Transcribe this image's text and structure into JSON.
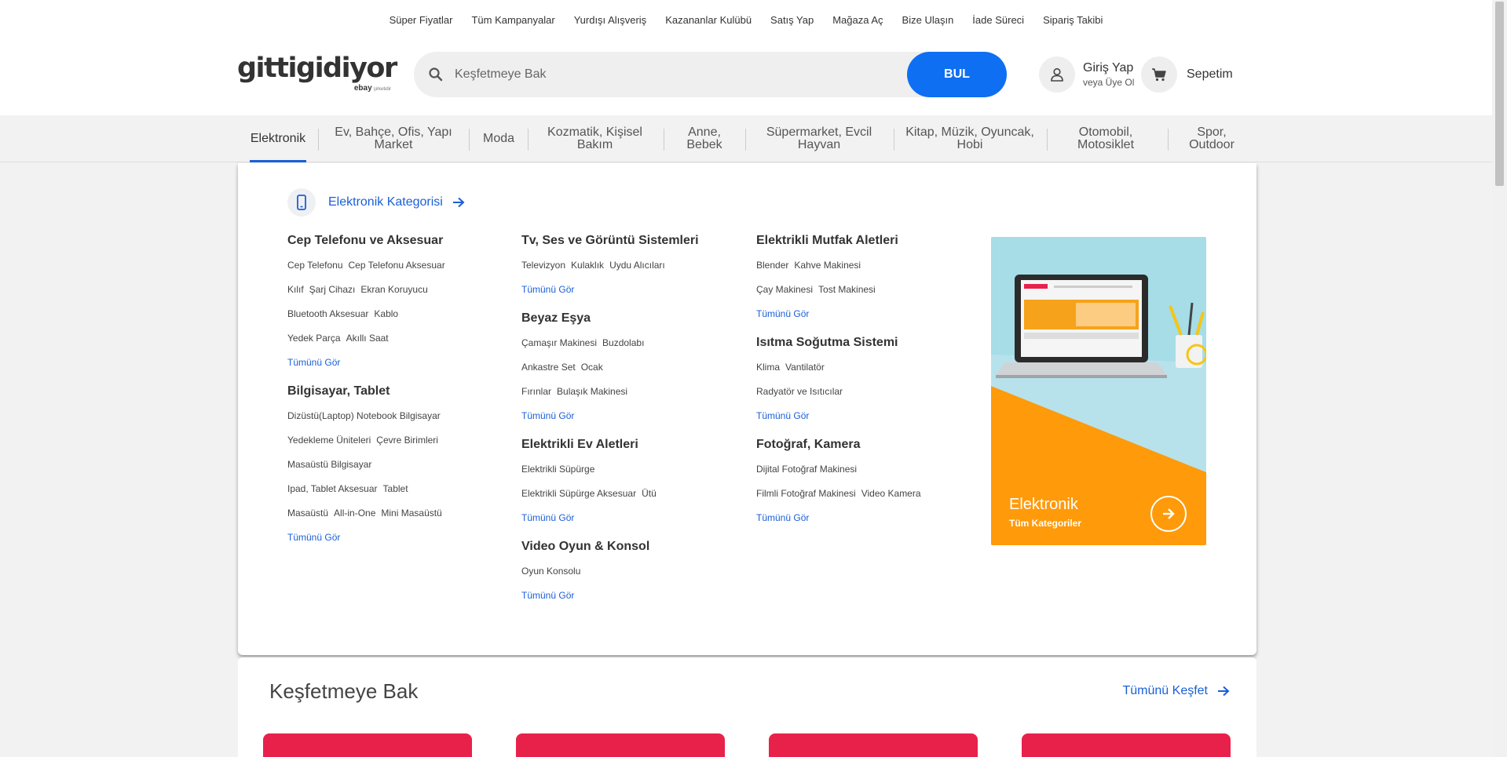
{
  "top_links": [
    "Süper Fiyatlar",
    "Tüm Kampanyalar",
    "Yurdışı Alışveriş",
    "Kazananlar Kulübü",
    "Satış Yap",
    "Mağaza Aç",
    "Bize Ulaşın",
    "İade Süreci",
    "Sipariş Takibi"
  ],
  "logo": {
    "text": "gittigidiyor",
    "sub": "ebay",
    "sub_small": "şirketidir"
  },
  "search": {
    "placeholder": "Keşfetmeye Bak",
    "button": "BUL"
  },
  "account": {
    "label": "Giriş Yap",
    "sublabel": "veya Üye Ol"
  },
  "cart": {
    "label": "Sepetim"
  },
  "categories": [
    "Elektronik",
    "Ev, Bahçe, Ofis, Yapı Market",
    "Moda",
    "Kozmatik, Kişisel Bakım",
    "Anne, Bebek",
    "Süpermarket, Evcil Hayvan",
    "Kitap, Müzik, Oyuncak, Hobi",
    "Otomobil, Motosiklet",
    "Spor, Outdoor"
  ],
  "active_category": "Elektronik",
  "mega_menu": {
    "heading": "Elektronik Kategorisi",
    "see_all": "Tümünü Gör",
    "col1": [
      {
        "title": "Cep Telefonu ve Aksesuar",
        "rows": [
          [
            "Cep Telefonu",
            "Cep Telefonu Aksesuar"
          ],
          [
            "Kılıf",
            "Şarj Cihazı",
            "Ekran Koruyucu"
          ],
          [
            "Bluetooth Aksesuar",
            "Kablo"
          ],
          [
            "Yedek Parça",
            "Akıllı Saat"
          ]
        ]
      },
      {
        "title": "Bilgisayar, Tablet",
        "rows": [
          [
            "Dizüstü(Laptop) Notebook Bilgisayar"
          ],
          [
            "Yedekleme Üniteleri",
            "Çevre Birimleri"
          ],
          [
            "Masaüstü Bilgisayar"
          ],
          [
            "Ipad, Tablet Aksesuar",
            "Tablet"
          ],
          [
            "Masaüstü",
            "All-in-One",
            "Mini Masaüstü"
          ]
        ]
      }
    ],
    "col2": [
      {
        "title": "Tv, Ses ve Görüntü Sistemleri",
        "rows": [
          [
            "Televizyon",
            "Kulaklık",
            "Uydu Alıcıları"
          ]
        ]
      },
      {
        "title": "Beyaz Eşya",
        "rows": [
          [
            "Çamaşır Makinesi",
            "Buzdolabı"
          ],
          [
            "Ankastre Set",
            "Ocak"
          ],
          [
            "Fırınlar",
            "Bulaşık Makinesi"
          ]
        ]
      },
      {
        "title": "Elektrikli Ev Aletleri",
        "rows": [
          [
            "Elektrikli Süpürge"
          ],
          [
            "Elektrikli Süpürge Aksesuar",
            "Ütü"
          ]
        ]
      },
      {
        "title": "Video Oyun & Konsol",
        "rows": [
          [
            "Oyun Konsolu"
          ]
        ]
      }
    ],
    "col3": [
      {
        "title": "Elektrikli Mutfak Aletleri",
        "rows": [
          [
            "Blender",
            "Kahve Makinesi"
          ],
          [
            "Çay Makinesi",
            "Tost Makinesi"
          ]
        ]
      },
      {
        "title": "Isıtma Soğutma Sistemi",
        "rows": [
          [
            "Klima",
            "Vantilatör"
          ],
          [
            "Radyatör ve Isıtıcılar"
          ]
        ]
      },
      {
        "title": "Fotoğraf, Kamera",
        "rows": [
          [
            "Dijital Fotoğraf Makinesi"
          ],
          [
            "Filmli Fotoğraf Makinesi",
            "Video Kamera"
          ]
        ]
      }
    ],
    "promo": {
      "title": "Elektronik",
      "subtitle": "Tüm Kategoriler"
    }
  },
  "explore": {
    "title": "Keşfetmeye Bak",
    "link": "Tümünü Keşfet"
  },
  "colors": {
    "primary_blue": "#0e6ff2",
    "link_blue": "#1a5fd8",
    "promo_orange": "#ff9a0a",
    "card_red": "#e8214b"
  }
}
